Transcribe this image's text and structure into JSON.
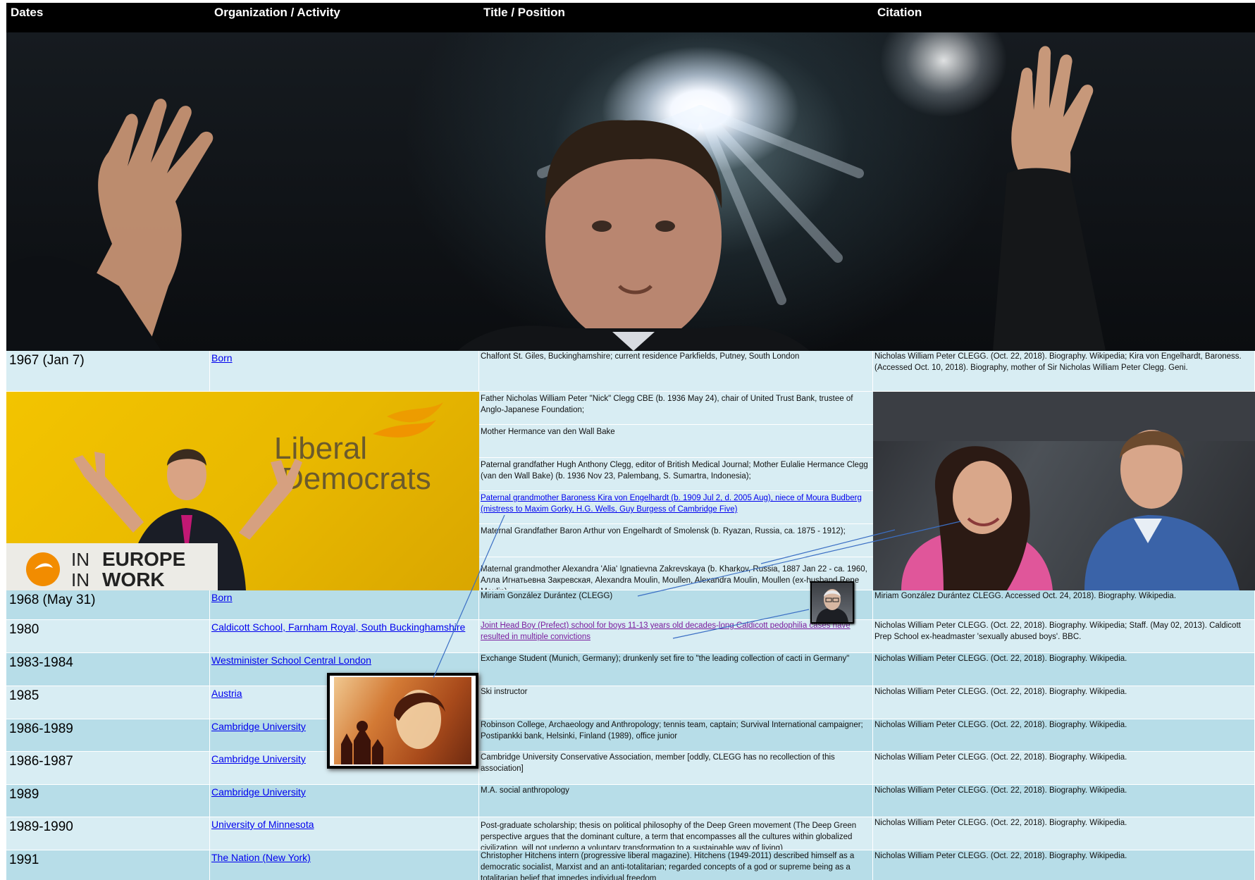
{
  "header": {
    "dates": "Dates",
    "org": "Organization / Activity",
    "title": "Title / Position",
    "citation": "Citation"
  },
  "rows": [
    {
      "date": "1967 (Jan 7)",
      "org": "Born",
      "title": "Chalfont St. Giles, Buckinghamshire; current residence Parkfields, Putney, South London",
      "citation": "Nicholas William Peter CLEGG. (Oct. 22, 2018). Biography. Wikipedia; Kira von Engelhardt, Baroness. (Accessed Oct. 10, 2018). Biography, mother of Sir Nicholas William Peter Clegg. Geni."
    },
    {
      "date": "1968 (May 31)",
      "org": "Born",
      "title": "Miriam González Durántez (CLEGG)",
      "citation": "Miriam González Durántez CLEGG. Accessed Oct. 24, 2018). Biography. Wikipedia."
    },
    {
      "date": "1980",
      "org": "Caldicott School, Farnham Royal,  South Buckinghamshire",
      "title": "Joint Head Boy (Prefect)  school for boys 11-13 years old  decades-long Caldicott pedophilia cases have resulted in multiple convictions",
      "citation": "Nicholas William Peter CLEGG. (Oct. 22, 2018). Biography. Wikipedia; Staff. (May 02, 2013). Caldicott Prep School ex-headmaster 'sexually abused boys'. BBC."
    },
    {
      "date": "1983-1984",
      "org": "Westminister School  Central London",
      "title": "Exchange Student (Munich, Germany); drunkenly set fire to \"the leading collection of cacti in Germany\"",
      "citation": "Nicholas William Peter CLEGG. (Oct. 22, 2018). Biography. Wikipedia."
    },
    {
      "date": "1985",
      "org": "Austria",
      "title": "Ski instructor",
      "citation": "Nicholas William Peter CLEGG. (Oct. 22, 2018). Biography. Wikipedia."
    },
    {
      "date": "1986-1989",
      "org": "Cambridge University",
      "title": "Robinson College, Archaeology and Anthropology; tennis team, captain; Survival International campaigner; Postipankki bank, Helsinki, Finland (1989), office junior",
      "citation": "Nicholas William Peter CLEGG. (Oct. 22, 2018). Biography. Wikipedia."
    },
    {
      "date": "1986-1987",
      "org": "Cambridge University",
      "title": "Cambridge University Conservative Association, member [oddly, CLEGG has no recollection of this association]",
      "citation": "Nicholas William Peter CLEGG. (Oct. 22, 2018). Biography. Wikipedia."
    },
    {
      "date": "1989",
      "org": "Cambridge University",
      "title": "M.A. social anthropology",
      "citation": "Nicholas William Peter CLEGG. (Oct. 22, 2018). Biography. Wikipedia."
    },
    {
      "date": "1989-1990",
      "org": "University of Minnesota",
      "title": "Post-graduate scholarship; thesis on political philosophy of the Deep Green movement (The Deep Green perspective argues that the dominant culture, a term that encompasses all the cultures within globalized civilization, will not undergo a voluntary transformation to a sustainable way of living)",
      "citation": "Nicholas William Peter CLEGG. (Oct. 22, 2018). Biography. Wikipedia."
    },
    {
      "date": "1991",
      "org": "The Nation (New York)",
      "title": "Christopher Hitchens intern (progressive liberal magazine). Hitchens  (1949-2011) described himself as a democratic socialist, Marxist and an anti-totalitarian; regarded concepts of a god or supreme being as a totalitarian belief that impedes individual freedom",
      "citation": "Nicholas William Peter CLEGG. (Oct. 22, 2018). Biography. Wikipedia."
    }
  ],
  "family": [
    "Father  Nicholas William Peter \"Nick\" Clegg CBE (b. 1936 May 24), chair of United Trust Bank, trustee of Anglo-Japanese Foundation;",
    "Mother  Hermance van den Wall Bake",
    "Paternal grandfather Hugh Anthony Clegg, editor of British Medical Journal; Mother  Eulalie Hermance Clegg (van den Wall Bake) (b. 1936 Nov 23, Palembang, S. Sumartra, Indonesia);",
    "Paternal grandmother  Baroness Kira von Engelhardt (b. 1909 Jul 2, d. 2005 Aug), niece of Moura Budberg (mistress to Maxim Gorky, H.G. Wells, Guy Burgess of Cambridge Five)",
    "Maternal Grandfather  Baron Arthur von Engelhardt of Smolensk (b. Ryazan, Russia, ca. 1875 - 1912);",
    "Maternal grandmother  Alexandra 'Alia' Ignatievna Zakrevskaya (b. Kharkov, Russia, 1887 Jan 22 - ca. 1960, Алла Игнатьевна Закревская, Alexandra Moulin, Moullen, Alexandra Moulin, Moullen (ex-husband Rene Moulin)"
  ],
  "photo_text": {
    "banner_liberal": "Liberal",
    "banner_democrats": "Democrats",
    "podium_line1_in": "IN",
    "podium_line1": "EUROPE",
    "podium_line2_in": "IN",
    "podium_line2": "WORK"
  },
  "colors": {
    "header_bg": "#000000",
    "row_light": "#d8edf3",
    "row_dark": "#b7dde8",
    "link": "#0000ee",
    "visited_link": "#7a1c9e",
    "connector": "#3b6fc4"
  }
}
